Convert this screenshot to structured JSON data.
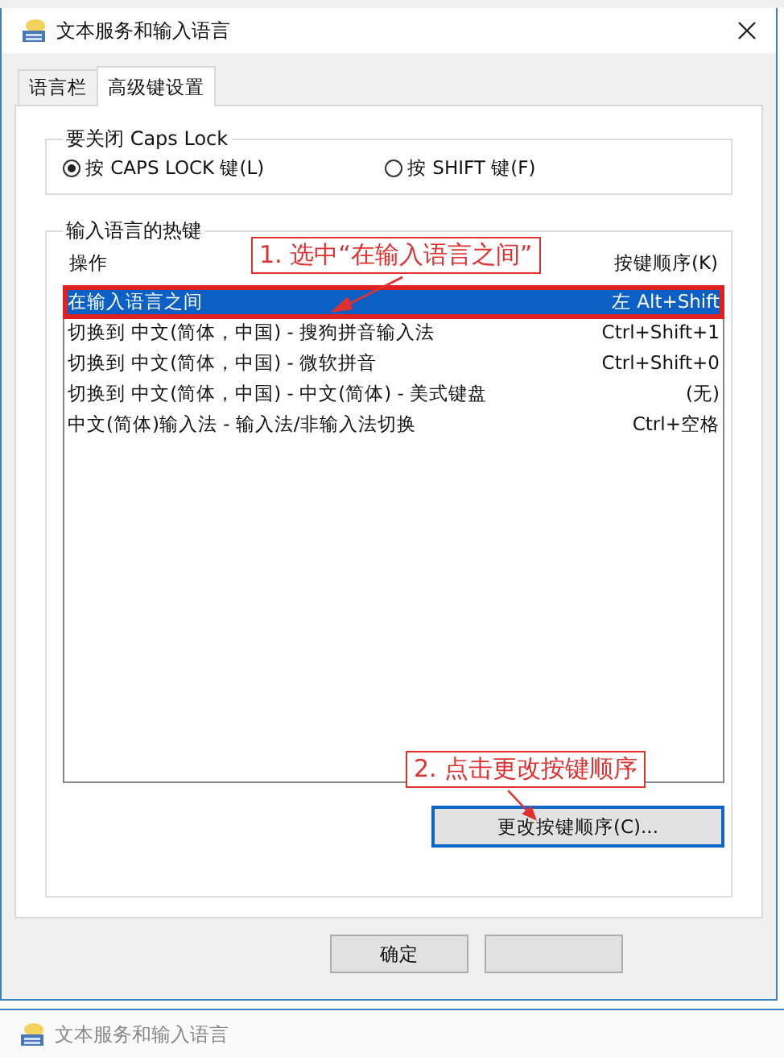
{
  "window": {
    "title": "文本服务和输入语言"
  },
  "tabs": [
    {
      "label": "语言栏",
      "selected": false
    },
    {
      "label": "高级键设置",
      "selected": true
    }
  ],
  "caps_lock": {
    "title": "要关闭 Caps Lock",
    "options": [
      {
        "label": "按 CAPS LOCK 键(L)",
        "selected": true
      },
      {
        "label": "按 SHIFT 键(F)",
        "selected": false
      }
    ]
  },
  "hotkeys": {
    "title": "输入语言的热键",
    "columns": [
      "操作",
      "按键顺序(K)"
    ],
    "rows": [
      {
        "action": "在输入语言之间",
        "keys": "左 Alt+Shift",
        "selected": true
      },
      {
        "action": "切换到 中文(简体，中国) - 搜狗拼音输入法",
        "keys": "Ctrl+Shift+1",
        "selected": false
      },
      {
        "action": "切换到 中文(简体，中国) - 微软拼音",
        "keys": "Ctrl+Shift+0",
        "selected": false
      },
      {
        "action": "切换到 中文(简体，中国) - 中文(简体) - 美式键盘",
        "keys": "(无)",
        "selected": false
      },
      {
        "action": "中文(简体)输入法 - 输入法/非输入法切换",
        "keys": "Ctrl+空格",
        "selected": false
      }
    ],
    "button": "更改按键顺序(C)..."
  },
  "annotations": [
    "1. 选中“在输入语言之间”",
    "2. 点击更改按键顺序"
  ],
  "buttons": [
    {
      "label": "确定"
    },
    {
      "kind": "unlabeled"
    }
  ],
  "background_window": {
    "title": "文本服务和输入语言"
  }
}
